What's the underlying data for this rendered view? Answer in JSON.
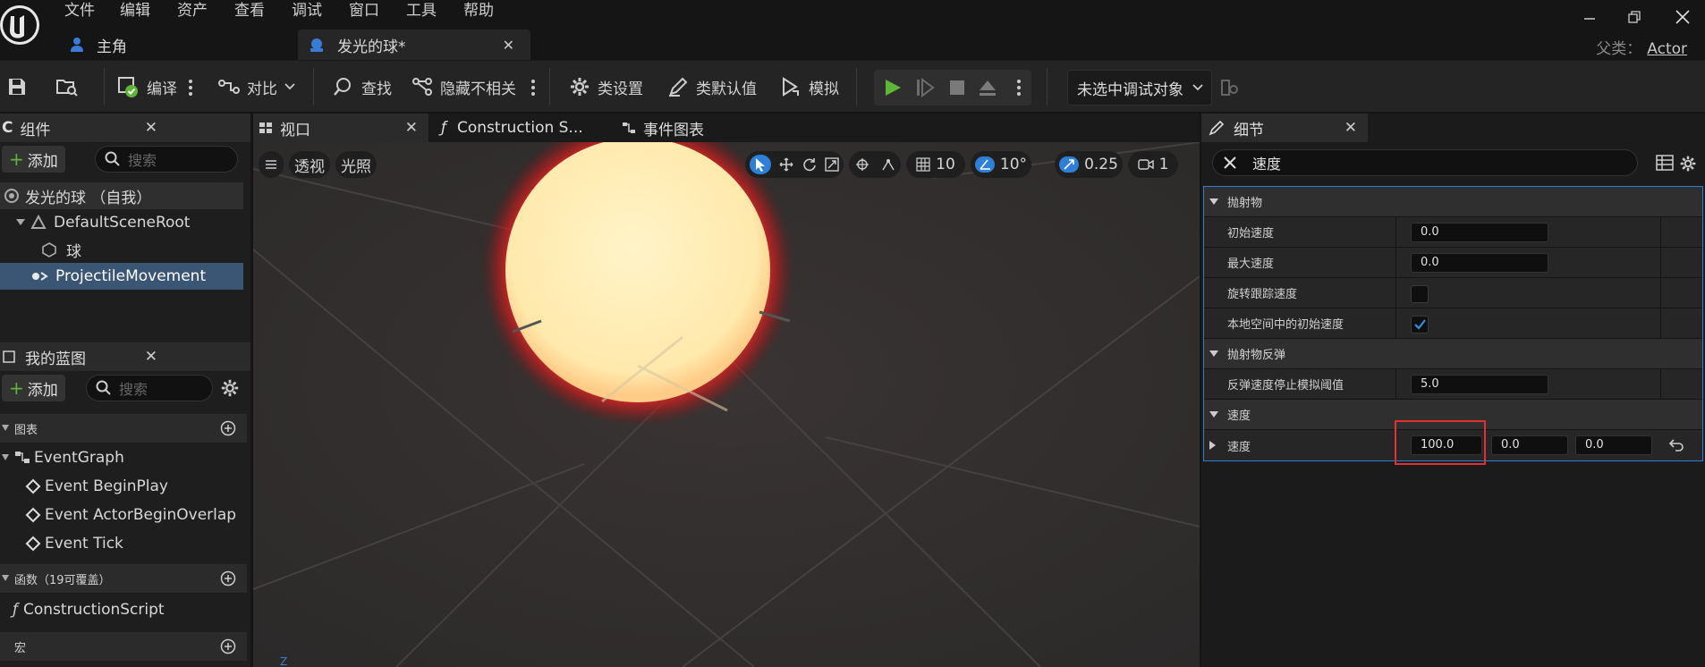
{
  "menu": [
    "文件",
    "编辑",
    "资产",
    "查看",
    "调试",
    "窗口",
    "工具",
    "帮助"
  ],
  "tabs": {
    "main": "主角",
    "ball": "发光的球*"
  },
  "parent": {
    "label": "父类：",
    "value": "Actor"
  },
  "toolbar": {
    "compile": "编译",
    "diff": "对比",
    "find": "查找",
    "hide_unrelated": "隐藏不相关",
    "class_settings": "类设置",
    "class_defaults": "类默认值",
    "simulate": "模拟",
    "debug_target": "未选中调试对象"
  },
  "components": {
    "title": "组件",
    "add": "添加",
    "search_placeholder": "搜索",
    "items": [
      "发光的球 （自我）",
      "DefaultSceneRoot",
      "球",
      "ProjectileMovement"
    ]
  },
  "blueprint": {
    "title": "我的蓝图",
    "add": "添加",
    "search_placeholder": "搜索",
    "graphs_header": "图表",
    "event_graph": "EventGraph",
    "events": [
      "Event BeginPlay",
      "Event ActorBeginOverlap",
      "Event Tick"
    ],
    "functions_header": "函数（19可覆盖）",
    "construction": "ConstructionScript",
    "macros_header": "宏"
  },
  "viewport": {
    "tabs": [
      "视口",
      "Construction S...",
      "事件图表"
    ],
    "perspective": "透视",
    "lit": "光照",
    "grid_snap": "10",
    "rot_snap": "10°",
    "scale_snap": "0.25",
    "cam_speed": "1",
    "colors": {
      "glow": "#ff2a2a",
      "sphere": "#ffefb8"
    }
  },
  "details": {
    "title": "细节",
    "search_value": "速度",
    "categories": {
      "projectile": "抛射物",
      "bounce": "抛射物反弹",
      "velocity": "速度"
    },
    "props": {
      "initial_speed": {
        "label": "初始速度",
        "value": "0.0"
      },
      "max_speed": {
        "label": "最大速度",
        "value": "0.0"
      },
      "rotation_follows": {
        "label": "旋转跟踪速度",
        "checked": false
      },
      "local_space": {
        "label": "本地空间中的初始速度",
        "checked": true
      },
      "bounce_threshold": {
        "label": "反弹速度停止模拟阈值",
        "value": "5.0"
      },
      "velocity": {
        "label": "速度",
        "x": "100.0",
        "y": "0.0",
        "z": "0.0"
      }
    },
    "highlight_color": "#e03030",
    "accent": "#2f7fd8"
  }
}
